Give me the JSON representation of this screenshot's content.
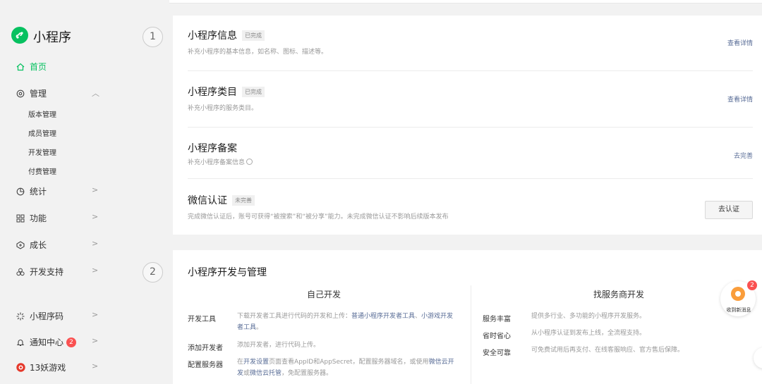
{
  "app": {
    "title": "小程序",
    "brand_color": "#07c160"
  },
  "sidebar": {
    "home": "首页",
    "manage": "管理",
    "manage_items": [
      "版本管理",
      "成员管理",
      "开发管理",
      "付费管理"
    ],
    "stats": "统计",
    "features": "功能",
    "growth": "成长",
    "dev_support": "开发支持",
    "qrcode": "小程序码",
    "notify": "通知中心",
    "notify_count": "2",
    "game": "13妖游戏"
  },
  "steps": {
    "one": "1",
    "two": "2"
  },
  "setup": {
    "info": {
      "title": "小程序信息",
      "tag": "已完成",
      "desc": "补充小程序的基本信息，如名称、图标、描述等。",
      "action": "查看详情"
    },
    "category": {
      "title": "小程序类目",
      "tag": "已完成",
      "desc": "补充小程序的服务类目。",
      "action": "查看详情"
    },
    "filing": {
      "title": "小程序备案",
      "desc": "补充小程序备案信息",
      "action": "去完善"
    },
    "verify": {
      "title": "微信认证",
      "tag": "未完善",
      "desc": "完成微信认证后，账号可获得“被搜索”和“被分享”能力。未完成微信认证不影响后续版本发布",
      "action": "去认证"
    }
  },
  "dev": {
    "title": "小程序开发与管理",
    "self_title": "自己开发",
    "vendor_title": "找服务商开发",
    "self_rows": [
      {
        "label": "开发工具",
        "t1": "下载开发者工具进行代码的开发和上传：",
        "l1": "普通小程序开发者工具",
        "t2": "、",
        "l2": "小游戏开发者工具",
        "t3": "。"
      },
      {
        "label": "添加开发者",
        "t1": "添加开发者，进行代码上传。"
      },
      {
        "label": "配置服务器",
        "t1": "在",
        "l1": "开发设置",
        "t2": "页面查看AppID和AppSecret，配置服务器域名，或使用",
        "l2": "微信云开发",
        "t3": "或",
        "l3": "微信云托管",
        "t4": "，免配置服务器。"
      }
    ],
    "vendor_rows": [
      {
        "label": "服务丰富",
        "text": "提供多行业、多功能的小程序开发服务。"
      },
      {
        "label": "省时省心",
        "text": "从小程序认证到发布上线，全流程支持。"
      },
      {
        "label": "安全可靠",
        "text": "可免费试用后再支付、在线客服响应、官方售后保障。"
      }
    ]
  },
  "float": {
    "badge": "2",
    "label": "收到新消息"
  }
}
